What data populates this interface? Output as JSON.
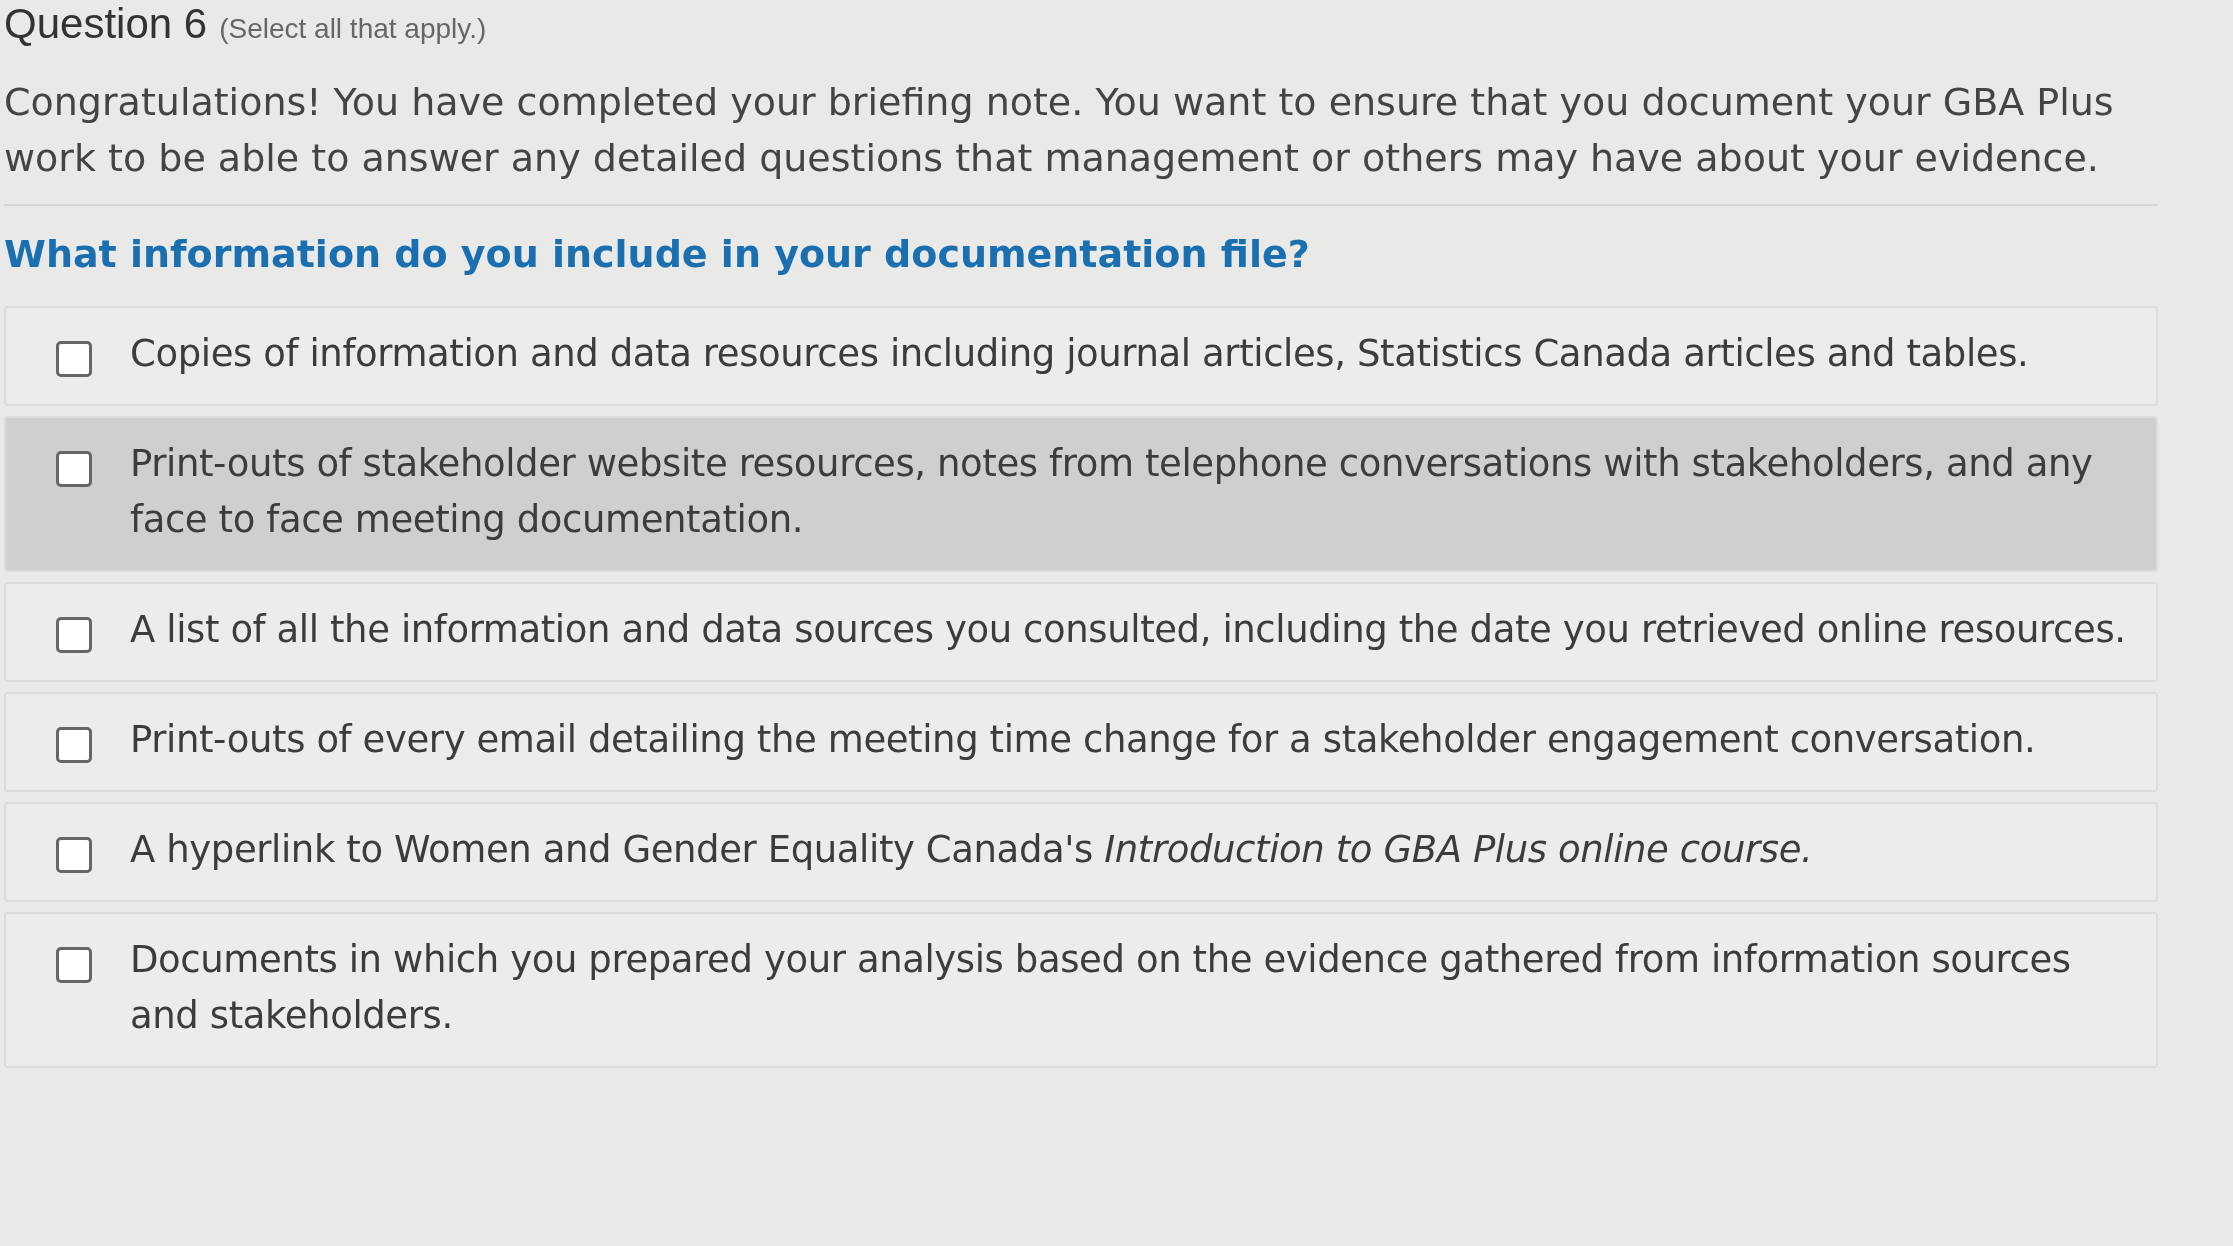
{
  "question": {
    "title": "Question 6",
    "hint": "(Select all that apply.)",
    "intro": "Congratulations! You have completed your briefing note. You want to ensure that you document your GBA Plus work to be able to answer any detailed questions that management or others may have about your evidence.",
    "prompt": "What information do you include in your documentation file?"
  },
  "options": [
    {
      "text": "Copies of information and data resources including journal articles, Statistics Canada articles and tables.",
      "checked": false,
      "hovered": false
    },
    {
      "text": "Print-outs of stakeholder website resources, notes from telephone conversations with stakeholders, and any face to face meeting documentation.",
      "checked": false,
      "hovered": true
    },
    {
      "text": "A list of all the information and data sources you consulted, including the date you retrieved online resources.",
      "checked": false,
      "hovered": false
    },
    {
      "text": "Print-outs of every email detailing the meeting time change for a stakeholder engagement conversation.",
      "checked": false,
      "hovered": false
    },
    {
      "text": "A hyperlink to Women and Gender Equality Canada's *Introduction to GBA Plus online course.*",
      "checked": false,
      "hovered": false
    },
    {
      "text": "Documents in which you prepared your analysis based on the evidence gathered from information sources and stakeholders.",
      "checked": false,
      "hovered": false
    }
  ]
}
